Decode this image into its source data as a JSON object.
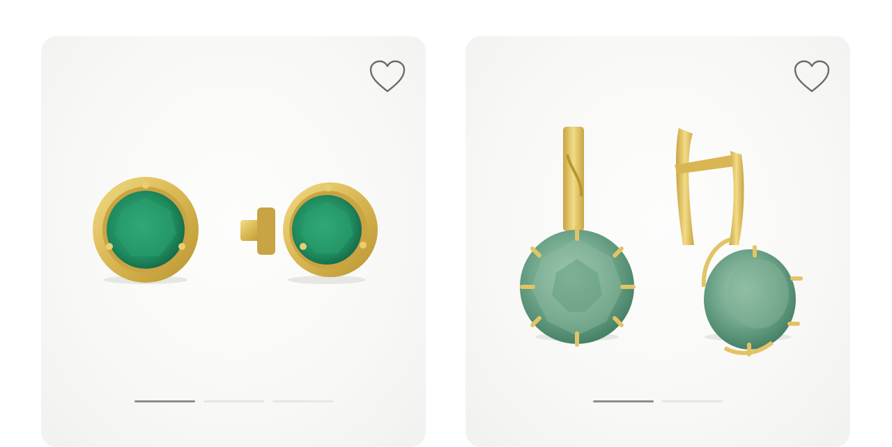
{
  "products": [
    {
      "image_name": "green-stud-earrings-image",
      "favorite_icon": "heart-outline-icon",
      "slides_total": 3,
      "active_slide": 1
    },
    {
      "image_name": "green-drop-earrings-image",
      "favorite_icon": "heart-outline-icon",
      "slides_total": 2,
      "active_slide": 1
    }
  ],
  "colors": {
    "card_background": "#f8f8f6",
    "indicator_active": "#8c8c8c",
    "indicator_inactive": "#e6e6e4",
    "heart_stroke": "#6b6b6b",
    "gold": "#e2c466",
    "stud_stone": "#2e9a6f",
    "drop_stone": "#6fa58a"
  }
}
